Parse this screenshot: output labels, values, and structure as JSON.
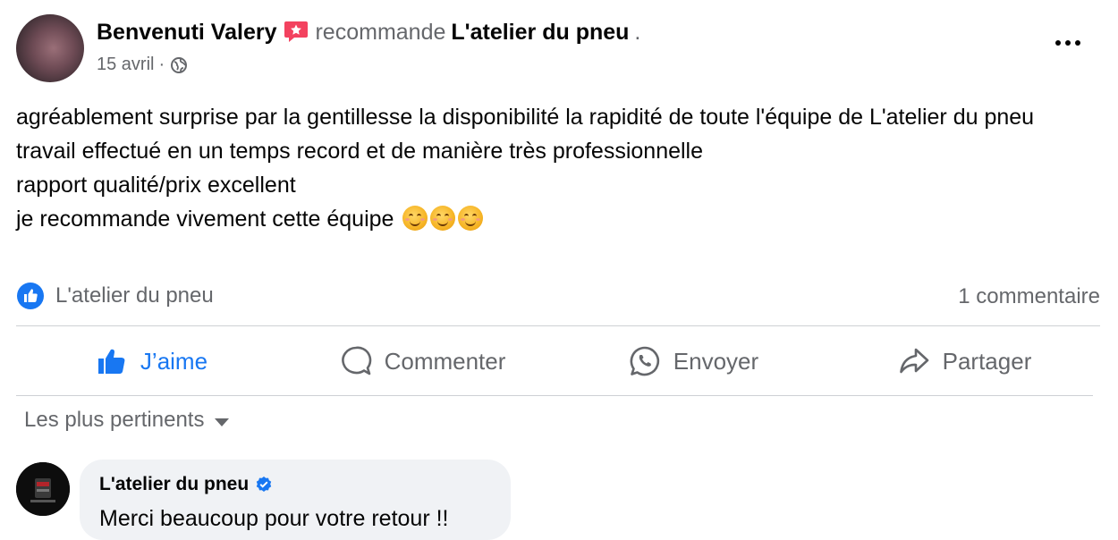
{
  "post": {
    "author": "Benvenuti Valery",
    "recommends": "recommande",
    "page_name": "L'atelier du pneu",
    "trailing_dot": ".",
    "date": "15 avril",
    "date_sep": "·",
    "text_lines": [
      "agréablement surprise par la gentillesse la disponibilité la rapidité de toute l'équipe de L'atelier du pneu",
      "travail effectué en un temps record et de manière très professionnelle",
      "rapport qualité/prix excellent",
      "je recommande vivement cette équipe"
    ],
    "emoji_count": 3
  },
  "reactions": {
    "liked_by": "L'atelier du pneu",
    "comments_count": "1 commentaire"
  },
  "actions": {
    "like": "J’aime",
    "comment": "Commenter",
    "send": "Envoyer",
    "share": "Partager"
  },
  "comments_sort": "Les plus pertinents",
  "comment": {
    "author": "L'atelier du pneu",
    "text": "Merci beaucoup pour votre retour !!"
  },
  "colors": {
    "accent": "#1877f2",
    "secondary_text": "#65676b",
    "bubble": "#f0f2f5",
    "recommend_badge": "#f3425f"
  }
}
